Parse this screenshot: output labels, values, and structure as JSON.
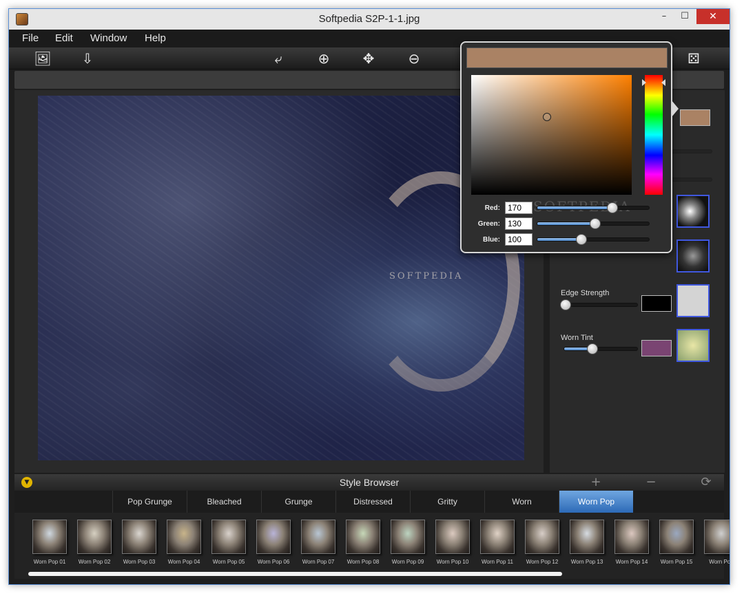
{
  "window": {
    "title": "Softpedia S2P-1-1.jpg",
    "minimize": "–",
    "maximize": "☐",
    "close": "✕"
  },
  "menu": [
    "File",
    "Edit",
    "Window",
    "Help"
  ],
  "toolbar": {
    "open": "🖼",
    "save": "⇩",
    "rotate": "⤶",
    "zoom_in": "⊕",
    "move": "✥",
    "zoom_out": "⊖",
    "dice": "⚄"
  },
  "image": {
    "watermark": "SOFTPEDIA"
  },
  "color_picker": {
    "preview_color": "#aa8264",
    "watermark": "SOFTPEDIA",
    "red": {
      "label": "Red:",
      "value": "170",
      "fraction": 0.667
    },
    "green": {
      "label": "Green:",
      "value": "130",
      "fraction": 0.51
    },
    "blue": {
      "label": "Blue:",
      "value": "100",
      "fraction": 0.392
    }
  },
  "right_panel": {
    "top_swatch": "#aa8264",
    "edge_strength": {
      "label": "Edge Strength",
      "value": 0.02,
      "swatch": "#000000"
    },
    "worn_tint": {
      "label": "Worn Tint",
      "value": 0.38,
      "swatch": "#7a4472"
    }
  },
  "style_browser": {
    "title": "Style Browser",
    "collapse_icon": "▼",
    "add": "+",
    "remove": "−",
    "reset": "⟳",
    "tabs": [
      "Pop Grunge",
      "Bleached",
      "Grunge",
      "Distressed",
      "Gritty",
      "Worn",
      "Worn Pop"
    ],
    "active_tab": "Worn Pop",
    "thumbnails": [
      "Worn Pop 01",
      "Worn Pop 02",
      "Worn Pop 03",
      "Worn Pop 04",
      "Worn Pop 05",
      "Worn Pop 06",
      "Worn Pop 07",
      "Worn Pop 08",
      "Worn Pop 09",
      "Worn Pop 10",
      "Worn Pop 11",
      "Worn Pop 12",
      "Worn Pop 13",
      "Worn Pop 14",
      "Worn Pop 15",
      "Worn Pop"
    ]
  }
}
